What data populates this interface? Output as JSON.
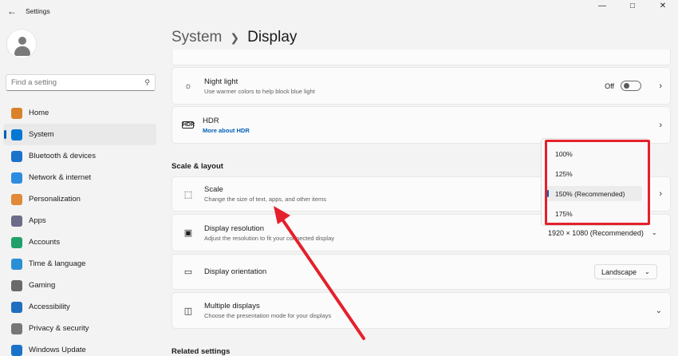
{
  "window": {
    "title": "Settings",
    "controls": [
      "—",
      "□",
      "✕"
    ]
  },
  "search": {
    "placeholder": "Find a setting"
  },
  "nav": [
    {
      "label": "Home",
      "color": "#d9822b"
    },
    {
      "label": "System",
      "color": "#0078d4"
    },
    {
      "label": "Bluetooth & devices",
      "color": "#1a73c9"
    },
    {
      "label": "Network & internet",
      "color": "#2d8ce0"
    },
    {
      "label": "Personalization",
      "color": "#e08a3a"
    },
    {
      "label": "Apps",
      "color": "#6b6b8a"
    },
    {
      "label": "Accounts",
      "color": "#21a06b"
    },
    {
      "label": "Time & language",
      "color": "#2b8fd6"
    },
    {
      "label": "Gaming",
      "color": "#6a6a6a"
    },
    {
      "label": "Accessibility",
      "color": "#1f6fc0"
    },
    {
      "label": "Privacy & security",
      "color": "#777777"
    },
    {
      "label": "Windows Update",
      "color": "#1a73c9"
    }
  ],
  "breadcrumb": {
    "parent": "System",
    "current": "Display"
  },
  "cards": {
    "night_light": {
      "title": "Night light",
      "subtitle": "Use warmer colors to help block blue light",
      "toggle_label": "Off"
    },
    "hdr": {
      "title": "HDR",
      "link": "More about HDR"
    },
    "scale": {
      "title": "Scale",
      "subtitle": "Change the size of text, apps, and other items"
    },
    "resolution": {
      "title": "Display resolution",
      "subtitle": "Adjust the resolution to fit your connected display",
      "value": "1920 × 1080 (Recommended)"
    },
    "orientation": {
      "title": "Display orientation",
      "value": "Landscape"
    },
    "multiple": {
      "title": "Multiple displays",
      "subtitle": "Choose the presentation mode for your displays"
    }
  },
  "sections": {
    "scale_layout": "Scale & layout",
    "related": "Related settings"
  },
  "scale_popup": {
    "options": [
      "100%",
      "125%",
      "150% (Recommended)",
      "175%"
    ],
    "selected_index": 2
  },
  "colors": {
    "accent": "#005fb8",
    "annotation_red": "#e5202c"
  }
}
